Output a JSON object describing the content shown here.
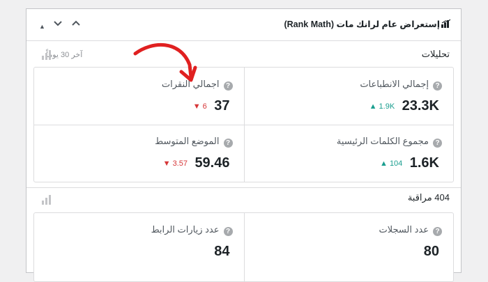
{
  "widget": {
    "title": "إستعراض عام لرانك مات (Rank Math)",
    "controls": {
      "up": "▲",
      "down": "⌄",
      "collapse": "⌃"
    }
  },
  "analytics": {
    "section_label": "تحليلات",
    "period": "آخر 30 يوماً",
    "stats": {
      "clicks": {
        "label": "اجمالي النقرات",
        "value": "37",
        "delta": "6",
        "trend": "down"
      },
      "impressions": {
        "label": "إجمالي الانطباعات",
        "value": "23.3K",
        "delta": "1.9K",
        "trend": "up"
      },
      "position": {
        "label": "الموضع المتوسط",
        "value": "59.46",
        "delta": "3.57",
        "trend": "down"
      },
      "keywords": {
        "label": "مجموع الكلمات الرئيسية",
        "value": "1.6K",
        "delta": "104",
        "trend": "up"
      }
    }
  },
  "monitor": {
    "section_label": "404 مراقبة",
    "stats": {
      "link_visits": {
        "label": "عدد زيارات الرابط",
        "value": "84"
      },
      "records": {
        "label": "عدد السجلات",
        "value": "80"
      }
    }
  },
  "colors": {
    "up": "#1a9e8f",
    "down": "#d63638",
    "annotation_arrow": "#e02020"
  },
  "icons": [
    "bar-chart-icon",
    "help-icon",
    "rank-math-logo-icon",
    "triangle-up-icon",
    "triangle-down-icon"
  ]
}
